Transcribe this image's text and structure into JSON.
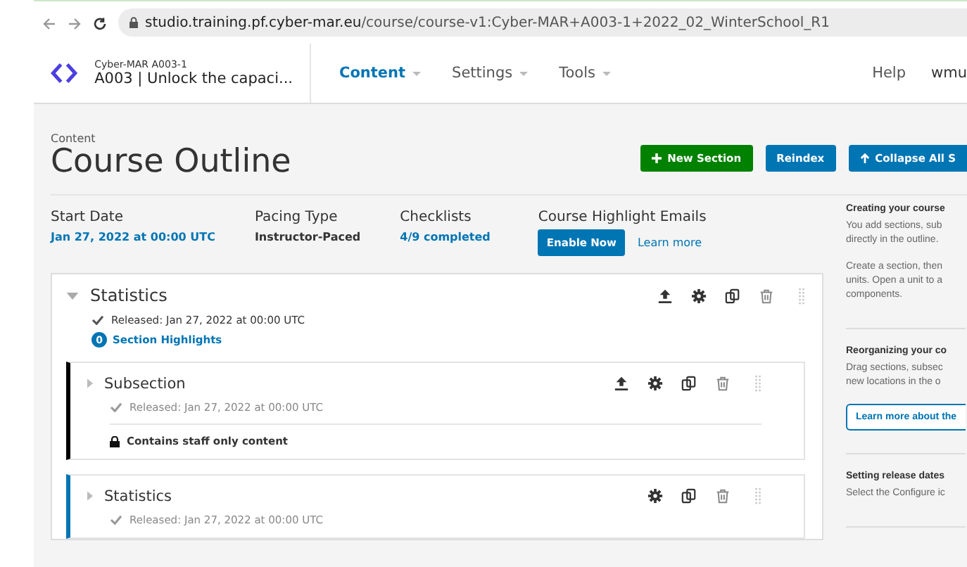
{
  "browser": {
    "host": "studio.training.pf.cyber-mar.eu",
    "path": "/course/course-v1:Cyber-MAR+A003-1+2022_02_WinterSchool_R1"
  },
  "header": {
    "org": "Cyber-MAR  A003-1",
    "title": "A003 | Unlock the capaci...",
    "nav": [
      {
        "label": "Content",
        "selected": true
      },
      {
        "label": "Settings",
        "selected": false
      },
      {
        "label": "Tools",
        "selected": false
      }
    ],
    "help": "Help",
    "user": "wmu"
  },
  "page": {
    "eyebrow": "Content",
    "title": "Course Outline",
    "actions": [
      {
        "label": "New Section",
        "kind": "success"
      },
      {
        "label": "Reindex",
        "kind": "primary"
      },
      {
        "label": "Collapse All S",
        "kind": "primary"
      }
    ]
  },
  "info": [
    {
      "label": "Start Date",
      "value": "Jan 27, 2022 at 00:00 UTC",
      "kind": "link"
    },
    {
      "label": "Pacing Type",
      "value": "Instructor-Paced",
      "kind": "text"
    },
    {
      "label": "Checklists",
      "value": "4/9 completed",
      "kind": "link"
    }
  ],
  "emails": {
    "label": "Course Highlight Emails",
    "button": "Enable Now",
    "link": "Learn more"
  },
  "section": {
    "title": "Statistics",
    "expanded": true,
    "released": "Released: Jan 27, 2022 at 00:00 UTC",
    "highlights_count": "0",
    "highlights_label": "Section Highlights",
    "publishable": true,
    "subsections": [
      {
        "title": "Subsection",
        "released": "Released: Jan 27, 2022 at 00:00 UTC",
        "note": "Contains staff only content",
        "color": "#000000",
        "expanded": false,
        "publishable": true
      },
      {
        "title": "Statistics",
        "released": "Released: Jan 27, 2022 at 00:00 UTC",
        "color": "#0075b4",
        "expanded": false,
        "publishable": false
      }
    ]
  },
  "sidebar": [
    {
      "kind": "text",
      "title": "Creating your course",
      "lines": [
        [
          "You add sections, sub",
          "directly in the outline."
        ],
        [
          "Create a section, then",
          "units. Open a unit to a",
          "components."
        ]
      ]
    },
    {
      "kind": "button",
      "title": "Reorganizing your co",
      "lines": [
        [
          "Drag sections, subsec",
          "new locations in the o"
        ]
      ],
      "button": "Learn more about the"
    },
    {
      "kind": "text",
      "title": "Setting release dates",
      "lines": [
        [
          "Select the Configure ic"
        ]
      ]
    }
  ]
}
